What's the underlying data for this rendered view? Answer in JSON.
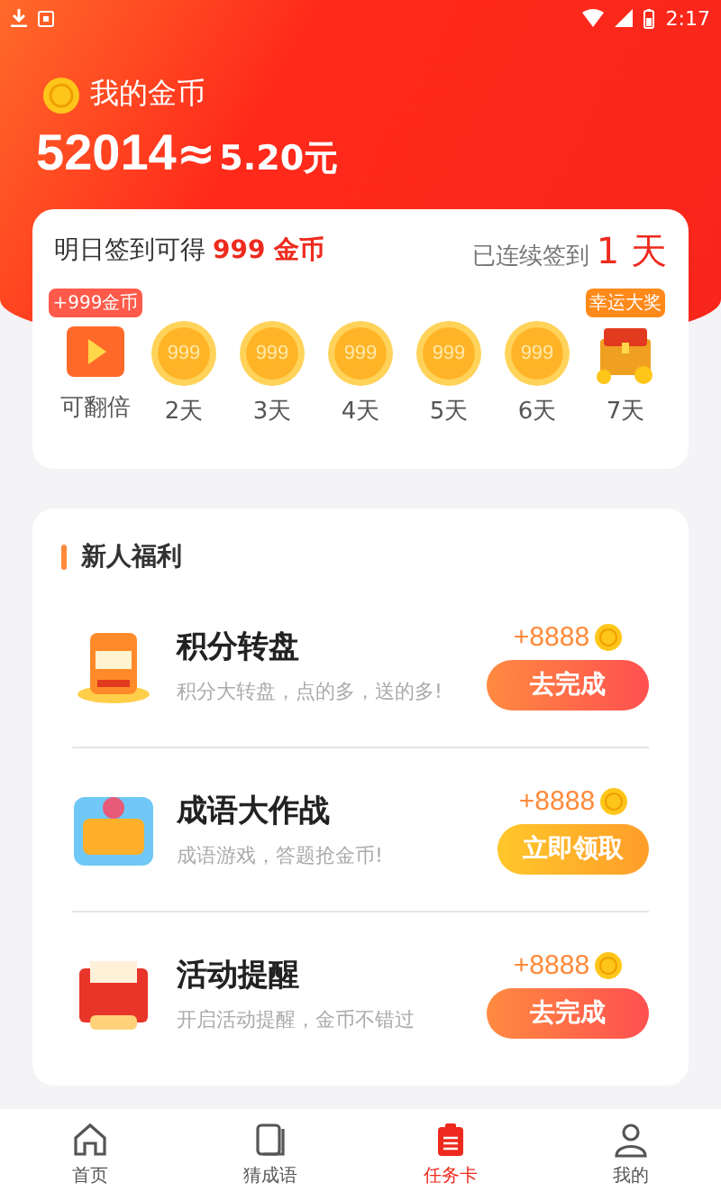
{
  "status_bar": {
    "time": "2:17"
  },
  "wallet": {
    "title": "我的金币",
    "coins": "52014",
    "approx": "≈",
    "money": "5.20元"
  },
  "sign_in": {
    "tomorrow_label": "明日签到可得",
    "tomorrow_amount": "999 金币",
    "streak_label": "已连续签到",
    "streak_value": "1 天",
    "days": [
      {
        "kind": "video",
        "badge": "+999金币",
        "label": "可翻倍"
      },
      {
        "kind": "coin",
        "coin_text": "999",
        "label": "2天"
      },
      {
        "kind": "coin",
        "coin_text": "999",
        "label": "3天"
      },
      {
        "kind": "coin",
        "coin_text": "999",
        "label": "4天"
      },
      {
        "kind": "coin",
        "coin_text": "999",
        "label": "5天"
      },
      {
        "kind": "coin",
        "coin_text": "999",
        "label": "6天"
      },
      {
        "kind": "chest",
        "badge": "幸运大奖",
        "label": "7天"
      }
    ]
  },
  "welfare": {
    "title": "新人福利",
    "tasks": [
      {
        "kind": "wheel",
        "title": "积分转盘",
        "desc": "积分大转盘，点的多，送的多!",
        "reward": "+8888",
        "button": {
          "kind": "complete",
          "label": "去完成"
        }
      },
      {
        "kind": "idiom",
        "title": "成语大作战",
        "desc": "成语游戏，答题抢金币!",
        "reward": "+8888",
        "button": {
          "kind": "claim",
          "label": "立即领取"
        }
      },
      {
        "kind": "reminder",
        "title": "活动提醒",
        "desc": "开启活动提醒，金币不错过",
        "reward": "+8888",
        "button": {
          "kind": "complete",
          "label": "去完成"
        }
      }
    ]
  },
  "tabs": [
    {
      "kind": "home",
      "label": "首页",
      "selected": false
    },
    {
      "kind": "book",
      "label": "猜成语",
      "selected": false
    },
    {
      "kind": "clipboard",
      "label": "任务卡",
      "selected": true
    },
    {
      "kind": "user",
      "label": "我的",
      "selected": false
    }
  ]
}
